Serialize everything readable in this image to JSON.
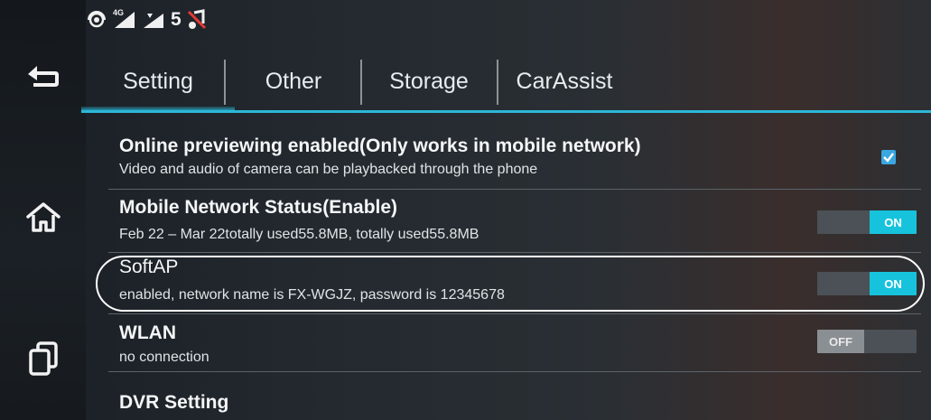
{
  "status_bar": {
    "icons": [
      "hotspot-icon",
      "4g-signal-icon",
      "wifi-signal-icon",
      "music-muted-icon"
    ],
    "network_label": "4G",
    "signal_count": "5"
  },
  "tabs": [
    {
      "label": "Setting",
      "selected": true
    },
    {
      "label": "Other",
      "selected": false
    },
    {
      "label": "Storage",
      "selected": false
    },
    {
      "label": "CarAssist",
      "selected": false
    }
  ],
  "nav": {
    "icons": [
      "back-icon",
      "home-icon",
      "recent-apps-icon"
    ]
  },
  "settings": [
    {
      "title": "Online previewing enabled(Only works in mobile network)",
      "subtitle": "Video and audio of camera can be playbacked through the phone",
      "control": "checkbox",
      "checked": true
    },
    {
      "title": "Mobile Network Status(Enable)",
      "subtitle": "Feb 22 – Mar 22totally used55.8MB, totally used55.8MB",
      "control": "toggle",
      "state": "ON"
    },
    {
      "title": "SoftAP",
      "subtitle": "enabled, network name is FX-WGJZ, password is 12345678",
      "control": "toggle",
      "state": "ON"
    },
    {
      "title": "WLAN",
      "subtitle": "no connection",
      "control": "toggle",
      "state": "OFF"
    },
    {
      "title": "DVR Setting",
      "subtitle": "",
      "control": "none"
    }
  ],
  "colors": {
    "accent": "#2bb8d8",
    "toggle_on": "#17c3dc",
    "checkbox": "#3aa7e0"
  }
}
